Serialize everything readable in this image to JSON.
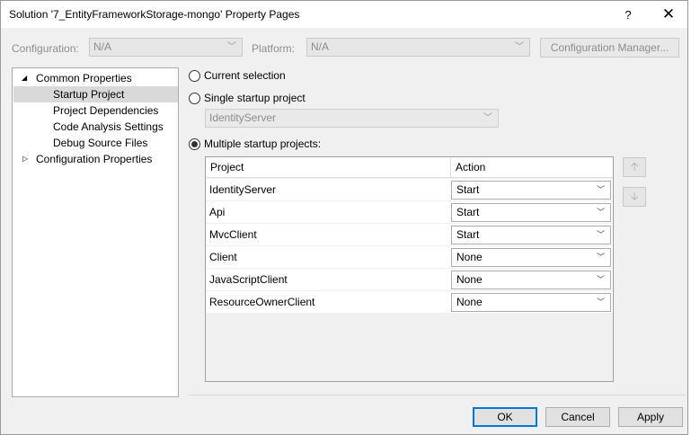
{
  "window": {
    "title": "Solution '7_EntityFrameworkStorage-mongo' Property Pages",
    "help_label": "?",
    "close_label": "✕"
  },
  "config": {
    "configuration_label": "Configuration:",
    "configuration_value": "N/A",
    "platform_label": "Platform:",
    "platform_value": "N/A",
    "manager_button": "Configuration Manager..."
  },
  "tree": {
    "common": "Common Properties",
    "items": [
      "Startup Project",
      "Project Dependencies",
      "Code Analysis Settings",
      "Debug Source Files"
    ],
    "configuration": "Configuration Properties",
    "selected_index": 0
  },
  "startup": {
    "current_selection": "Current selection",
    "single": "Single startup project",
    "single_value": "IdentityServer",
    "multiple": "Multiple startup projects:",
    "selected_option": "multiple"
  },
  "grid": {
    "col_project": "Project",
    "col_action": "Action",
    "rows": [
      {
        "project": "IdentityServer",
        "action": "Start"
      },
      {
        "project": "Api",
        "action": "Start"
      },
      {
        "project": "MvcClient",
        "action": "Start"
      },
      {
        "project": "Client",
        "action": "None"
      },
      {
        "project": "JavaScriptClient",
        "action": "None"
      },
      {
        "project": "ResourceOwnerClient",
        "action": "None"
      }
    ]
  },
  "buttons": {
    "ok": "OK",
    "cancel": "Cancel",
    "apply": "Apply"
  },
  "icons": {
    "expanded": "triangle-down-icon",
    "collapsed": "triangle-right-icon",
    "dropdown": "chevron-down-icon",
    "move_up": "arrow-up-icon",
    "move_down": "arrow-down-icon"
  },
  "colors": {
    "selected_tree_bg": "#d9d9d9",
    "default_button_border": "#0078d7"
  }
}
